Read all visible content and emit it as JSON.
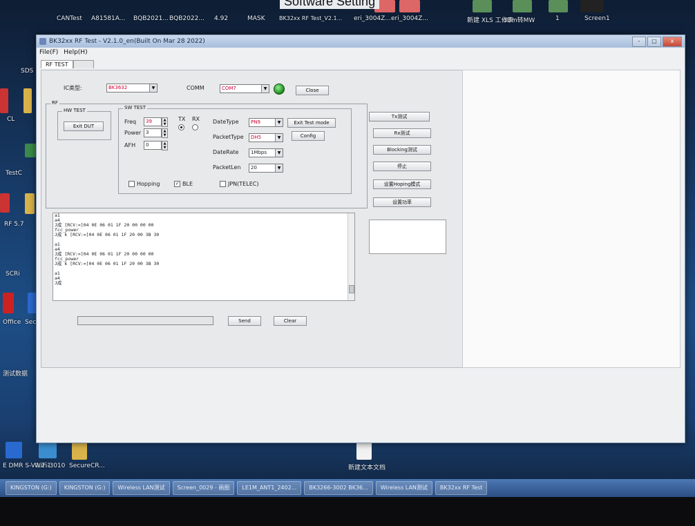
{
  "photo_caption": "Software Setting",
  "desktop": {
    "top_icons": [
      "CANTest",
      "A81581A...",
      "BQB2021...",
      "BQB2022...",
      "4.92",
      "MASK",
      "BK32xx RF Test_V2.1...",
      "eri_3004Z...",
      "eri_3004Z...",
      "新建 XLS 工作表",
      "dBm转MW",
      "1",
      "Screen1"
    ],
    "left_icons": [
      "SDS",
      "CL",
      "TestC",
      "RF 5.7",
      "SCRi",
      "Office",
      "Secur",
      "测试数据"
    ],
    "bottom_icons": [
      "E DMR S-V2.2.1",
      "WiFi-3010",
      "SecureCR...",
      "新建文本文档"
    ]
  },
  "window": {
    "title": "BK32xx RF Test - V2.1.0_en(Built On Mar 28 2022)",
    "menu": [
      "File(F)",
      "Help(H)"
    ],
    "buttons": {
      "minimize": "-",
      "maximize": "□",
      "close": "x"
    },
    "tabs": [
      "RF TEST",
      ""
    ]
  },
  "top_row": {
    "ic_label": "IC类型:",
    "ic_value": "BK3632",
    "comm_label": "COMM",
    "comm_value": "COM7",
    "close_button": "Close"
  },
  "rf": {
    "group_label": "RF",
    "hw_test": {
      "label": "HW TEST",
      "exit_dut": "Exit DUT"
    },
    "sw_test": {
      "label": "SW TEST",
      "freq_label": "Freq",
      "freq_value": "39",
      "power_label": "Power",
      "power_value": "3",
      "afh_label": "AFH",
      "afh_value": "0",
      "tx_label": "TX",
      "rx_label": "RX",
      "datatype_label": "DateType",
      "datatype_value": "PN9",
      "packettype_label": "PacketType",
      "packettype_value": "DH5",
      "datarate_label": "DateRate",
      "datarate_value": "1Mbps",
      "packetlen_label": "PacketLen",
      "packetlen_value": "20",
      "exit_test_mode": "Exit Test mode",
      "config": "Config",
      "hopping_label": "Hopping",
      "ble_label": "BLE",
      "jpn_label": "JPN(TELEC)"
    }
  },
  "side_buttons": [
    "Tx测试",
    "Rx测试",
    "Blocking测试",
    "停止",
    "设置Hoping模式",
    "设置功率"
  ],
  "log": [
    "a1",
    "a4",
    "J成    [RCV:=]04 0E 06 01 1F 20 00 00 00",
    "fcc_power",
    "J成  k [RCV:=]04 0E 06 01 1F 20 00 3B 30",
    "",
    "a1",
    "a4",
    "J成    [RCV:=]04 0E 06 01 1F 20 00 00 00",
    "fcc_power",
    "J成  k [RCV:=]04 0E 06 01 1F 20 00 3B 30",
    "",
    "a1",
    "a4",
    "J成"
  ],
  "send_bar": {
    "send": "Send",
    "clear": "Clear"
  },
  "taskbar": {
    "items": [
      "KINGSTON (G:)",
      "KINGSTON (G:)",
      "Wireless LAN测试",
      "Screen_0029 - 画图",
      "LE1M_ANT1_2402...",
      "BK3266-3002 BK36...",
      "Wireless LAN测试",
      "BK32xx RF Test"
    ]
  },
  "colors": {
    "led": "#1d8a1d",
    "combo_text": "#cc0033",
    "titlebar": "#a7bfdc"
  }
}
